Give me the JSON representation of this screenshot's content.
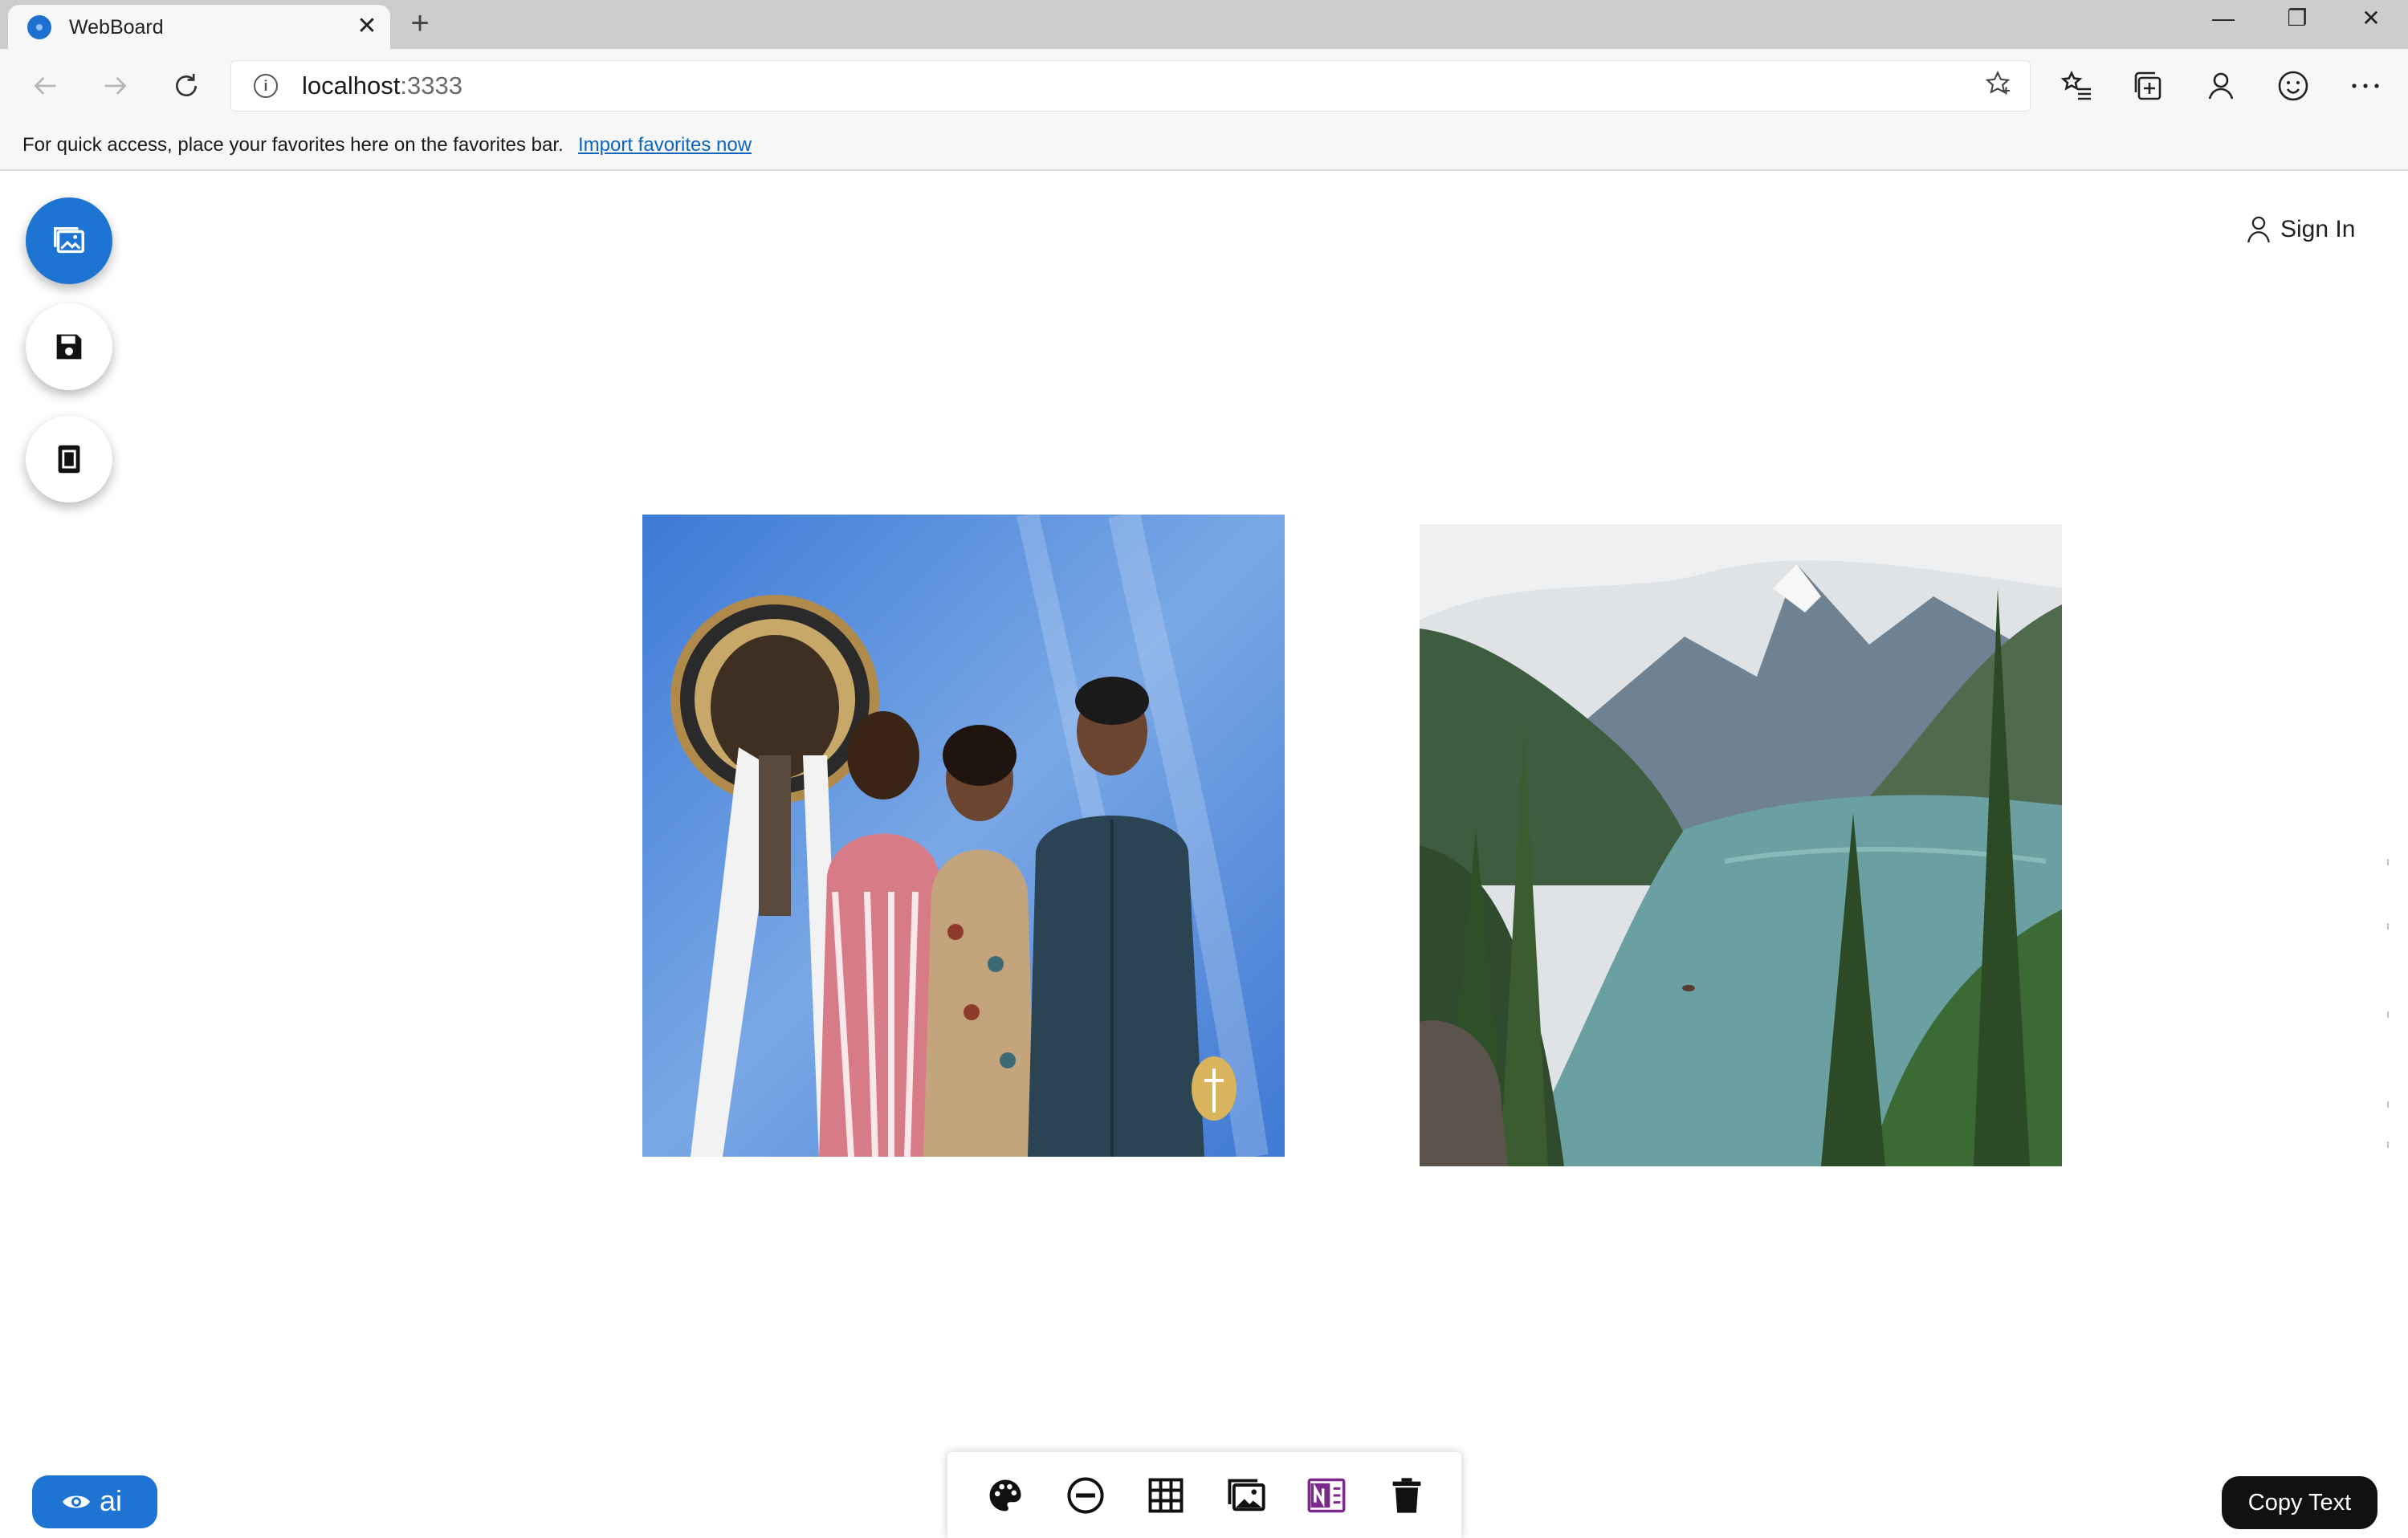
{
  "browser": {
    "tab_title": "WebBoard",
    "tab_close": "✕",
    "new_tab": "+",
    "url_host": "localhost",
    "url_port": ":3333",
    "window_controls": {
      "minimize": "—",
      "restore": "❐",
      "close": "✕"
    },
    "favorites_bar": {
      "message": "For quick access, place your favorites here on the favorites bar.",
      "link": "Import favorites now"
    },
    "icons": [
      "back-arrow-icon",
      "forward-arrow-icon",
      "refresh-icon",
      "info-icon",
      "favorite-star-icon",
      "favorites-list-icon",
      "collections-icon",
      "profile-icon",
      "feedback-smiley-icon",
      "more-dots-icon"
    ]
  },
  "page": {
    "sign_in": "Sign In",
    "left_fabs": [
      {
        "name": "images-fab",
        "icon": "images-icon",
        "active": true
      },
      {
        "name": "save-fab",
        "icon": "floppy-disk-icon",
        "active": false
      },
      {
        "name": "calculator-fab",
        "icon": "calculator-icon",
        "active": false
      }
    ],
    "photos": [
      {
        "name": "photo-space-needle-family",
        "description_icon": "photo"
      },
      {
        "name": "photo-mountain-lake",
        "description_icon": "photo"
      }
    ],
    "ai_button": {
      "label": "ai",
      "icon": "eye-icon"
    },
    "bottom_toolbar": [
      {
        "name": "palette-button",
        "icon": "palette-icon"
      },
      {
        "name": "remove-button",
        "icon": "minus-circle-icon"
      },
      {
        "name": "grid-button",
        "icon": "grid-icon"
      },
      {
        "name": "image-button",
        "icon": "images-icon"
      },
      {
        "name": "onenote-button",
        "icon": "onenote-icon"
      },
      {
        "name": "delete-button",
        "icon": "trash-icon"
      }
    ],
    "copy_text_button": "Copy Text"
  },
  "colors": {
    "accent": "#1e74d3",
    "onenote": "#7b2a8c",
    "link": "#0b64c0",
    "copy_button_bg": "#111111"
  }
}
